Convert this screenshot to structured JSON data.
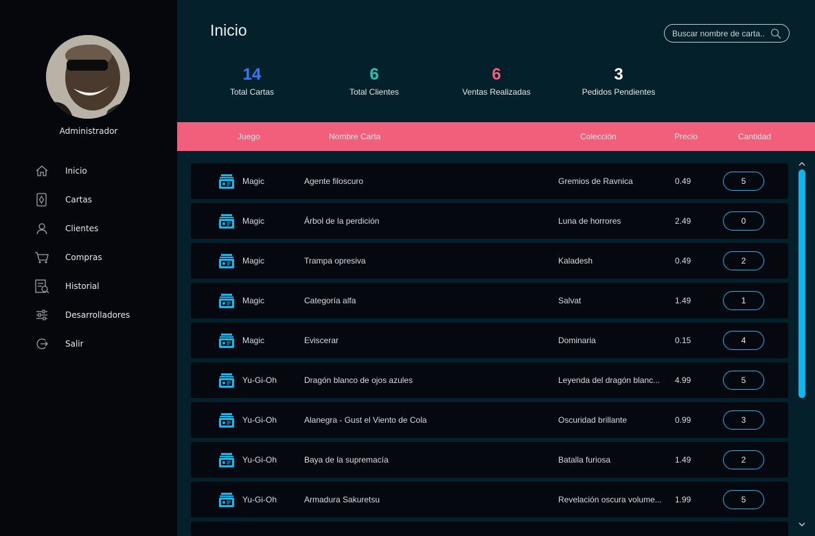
{
  "sidebar": {
    "user_label": "Administrador",
    "items": [
      {
        "label": "Inicio",
        "icon": "home-icon"
      },
      {
        "label": "Cartas",
        "icon": "cards-icon"
      },
      {
        "label": "Clientes",
        "icon": "user-icon"
      },
      {
        "label": "Compras",
        "icon": "cart-icon"
      },
      {
        "label": "Historial",
        "icon": "history-icon"
      },
      {
        "label": "Desarrolladores",
        "icon": "sliders-icon"
      },
      {
        "label": "Salir",
        "icon": "logout-icon"
      }
    ]
  },
  "header": {
    "title": "Inicio",
    "search_placeholder": "Buscar nombre de carta.."
  },
  "stats": [
    {
      "value": "14",
      "label": "Total Cartas",
      "color": "#2f7cf6"
    },
    {
      "value": "6",
      "label": "Total Clientes",
      "color": "#1fc6b7"
    },
    {
      "value": "6",
      "label": "Ventas Realizadas",
      "color": "#f25f7a"
    },
    {
      "value": "3",
      "label": "Pedidos Pendientes",
      "color": "#ffffff"
    }
  ],
  "table": {
    "columns": [
      "Juego",
      "Nombre Carta",
      "Colección",
      "Precio",
      "Cantidad"
    ],
    "rows": [
      {
        "game": "Magic",
        "name": "Agente filoscuro",
        "collection": "Gremios de Ravnica",
        "price": "0.49",
        "qty": "5"
      },
      {
        "game": "Magic",
        "name": "Árbol de la perdición",
        "collection": "Luna de horrores",
        "price": "2.49",
        "qty": "0"
      },
      {
        "game": "Magic",
        "name": "Trampa opresiva",
        "collection": "Kaladesh",
        "price": "0.49",
        "qty": "2"
      },
      {
        "game": "Magic",
        "name": "Categoría alfa",
        "collection": "Salvat",
        "price": "1.49",
        "qty": "1"
      },
      {
        "game": "Magic",
        "name": "Eviscerar",
        "collection": "Dominaria",
        "price": "0.15",
        "qty": "4"
      },
      {
        "game": "Yu-Gi-Oh",
        "name": "Dragón blanco de ojos azules",
        "collection": "Leyenda del dragón blanc...",
        "price": "4.99",
        "qty": "5"
      },
      {
        "game": "Yu-Gi-Oh",
        "name": "Alanegra - Gust el Viento de Cola",
        "collection": "Oscuridad brillante",
        "price": "0.99",
        "qty": "3"
      },
      {
        "game": "Yu-Gi-Oh",
        "name": "Baya de la supremacía",
        "collection": "Batalla furiosa",
        "price": "1.49",
        "qty": "2"
      },
      {
        "game": "Yu-Gi-Oh",
        "name": "Armadura Sakuretsu",
        "collection": "Revelación oscura volume...",
        "price": "1.99",
        "qty": "5"
      }
    ]
  },
  "colors": {
    "accent_pink": "#f25f7a",
    "accent_cyan": "#10b7ee",
    "sidebar_bg": "#05070d",
    "main_bg": "#04202a"
  }
}
